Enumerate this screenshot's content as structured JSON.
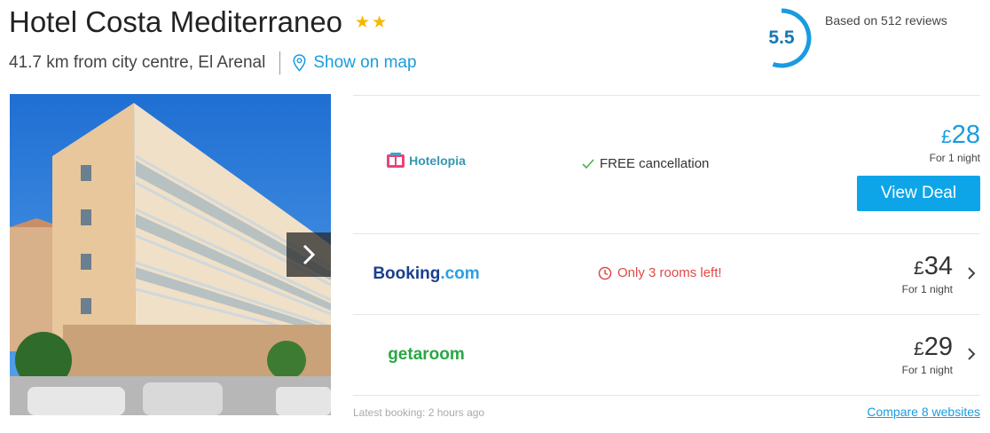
{
  "hotel": {
    "name": "Hotel Costa Mediterraneo",
    "star_count": 2,
    "distance": "41.7 km from city centre, El Arenal",
    "map_link": "Show on map"
  },
  "rating": {
    "score": "5.5",
    "fraction": 0.55,
    "reviews": "Based on 512 reviews",
    "ring_color": "#1a9be0"
  },
  "gallery": {
    "next_icon": "chevron-right-icon"
  },
  "deals": [
    {
      "provider": "Hotelopia",
      "feature": "FREE cancellation",
      "feature_icon": "checkmark-icon",
      "currency": "£",
      "price": "28",
      "period": "For 1 night",
      "cta": "View Deal",
      "accent": "#0ea5e8"
    },
    {
      "provider_part1": "Booking",
      "provider_part2": ".com",
      "feature": "Only 3 rooms left!",
      "feature_icon": "clock-icon",
      "currency": "£",
      "price": "34",
      "period": "For 1 night",
      "accent": "#e04848"
    },
    {
      "provider": "getaroom",
      "currency": "£",
      "price": "29",
      "period": "For 1 night"
    }
  ],
  "footer": {
    "latest_booking": "Latest booking: 2 hours ago",
    "compare": "Compare 8 websites"
  }
}
